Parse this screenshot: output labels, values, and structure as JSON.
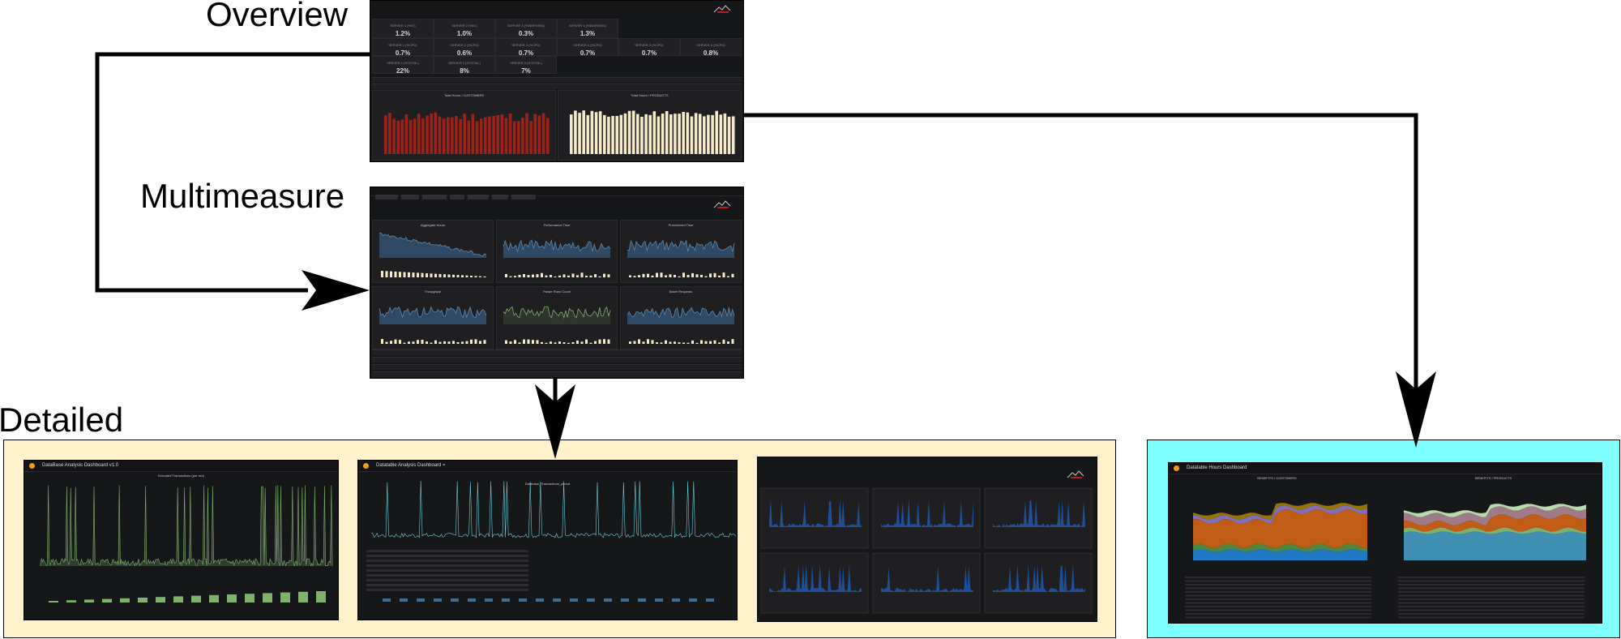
{
  "labels": {
    "overview": "Overview",
    "multimeasure": "Multimeasure",
    "detailed": "Detailed"
  },
  "colors": {
    "arrow": "#000000",
    "detailed_bg": "#fff2cc",
    "right_bg": "#80ffff",
    "dash_bg": "#161719",
    "red_bars": "#9e2218",
    "cream_bars": "#f6e9c8",
    "blue_series": "#3b6c9a",
    "green_series": "#7eb26d"
  },
  "overview_stats": [
    {
      "title": "SERVER 1 (%IO)",
      "value": "1.2%"
    },
    {
      "title": "SERVER 2 (%IO)",
      "value": "1.0%"
    },
    {
      "title": "SERVER 3 (%WARNING)",
      "value": "0.3%"
    },
    {
      "title": "SERVER 4 (%WARNING)",
      "value": "1.3%"
    },
    {
      "title": "SERVER 1 (%CPU)",
      "value": "0.7%"
    },
    {
      "title": "SERVER 2 (%CPU)",
      "value": "0.6%"
    },
    {
      "title": "SERVER 3 (%CPU)",
      "value": "0.7%"
    },
    {
      "title": "SERVER 4 (%CPU)",
      "value": "0.7%"
    },
    {
      "title": "SERVER 5 (%CPU)",
      "value": "0.7%"
    },
    {
      "title": "SERVER 6 (%CPU)",
      "value": "0.8%"
    },
    {
      "title": "SERVER 1 (%TOTAL)",
      "value": "22%"
    },
    {
      "title": "SERVER 2 (%TOTAL)",
      "value": "8%"
    },
    {
      "title": "SERVER 3 (%TOTAL)",
      "value": "7%"
    }
  ],
  "overview_panels": {
    "left_title": "Total Hours / CUSTOMERS",
    "right_title": "Total Hours / PRODUCTS"
  },
  "multimeasure_panels": [
    {
      "title": "Aggregate Hours"
    },
    {
      "title": "Performance Time"
    },
    {
      "title": "Provisioned Time"
    },
    {
      "title": "Throughput"
    },
    {
      "title": "Parser Runs Count"
    },
    {
      "title": "Batch Requests"
    }
  ],
  "detailed_dashboards": [
    {
      "title": "DataBase Analysis Dashboard v1.0"
    },
    {
      "title": "Datatable Analysis Dashboard ="
    },
    {
      "title": ""
    }
  ],
  "detailed_panel_titles": {
    "first": "Executed Transactions (per sec)",
    "second": "Database_Transactions_period"
  },
  "right_dashboard": {
    "title": "Datatable Hours Dashboard",
    "panel_left": "BENEFITS / CUSTOMERS",
    "panel_right": "BENEFITS / PRODUCTS"
  }
}
